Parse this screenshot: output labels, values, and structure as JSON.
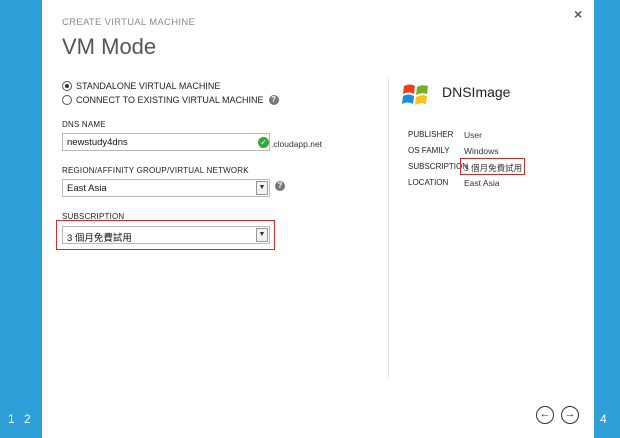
{
  "wizard": {
    "label": "CREATE VIRTUAL MACHINE",
    "title": "VM Mode",
    "steps": {
      "first": "1",
      "second": "2",
      "fourth": "4"
    },
    "close": "×"
  },
  "mode": {
    "standalone_label": "STANDALONE VIRTUAL MACHINE",
    "connect_label": "CONNECT TO EXISTING VIRTUAL MACHINE",
    "help": "?"
  },
  "dns": {
    "label": "DNS NAME",
    "value": "newstudy4dns",
    "suffix": ".cloudapp.net",
    "ok": "✓"
  },
  "region": {
    "label": "REGION/AFFINITY GROUP/VIRTUAL NETWORK",
    "value": "East Asia",
    "arrow": "▼",
    "help": "?"
  },
  "subscription": {
    "label": "SUBSCRIPTION",
    "value": "3 個月免費試用",
    "arrow": "▼"
  },
  "summary": {
    "image_name": "DNSImage",
    "publisher_label": "PUBLISHER",
    "publisher_value": "User",
    "os_label": "OS FAMILY",
    "os_value": "Windows",
    "subscription_label": "SUBSCRIPTION",
    "subscription_value": "3 個月免費試用",
    "location_label": "LOCATION",
    "location_value": "East Asia"
  },
  "nav": {
    "back": "←",
    "next": "→"
  },
  "colors": {
    "accent": "#2e9fd8",
    "highlight": "#d02a2a",
    "ok": "#39a639"
  }
}
